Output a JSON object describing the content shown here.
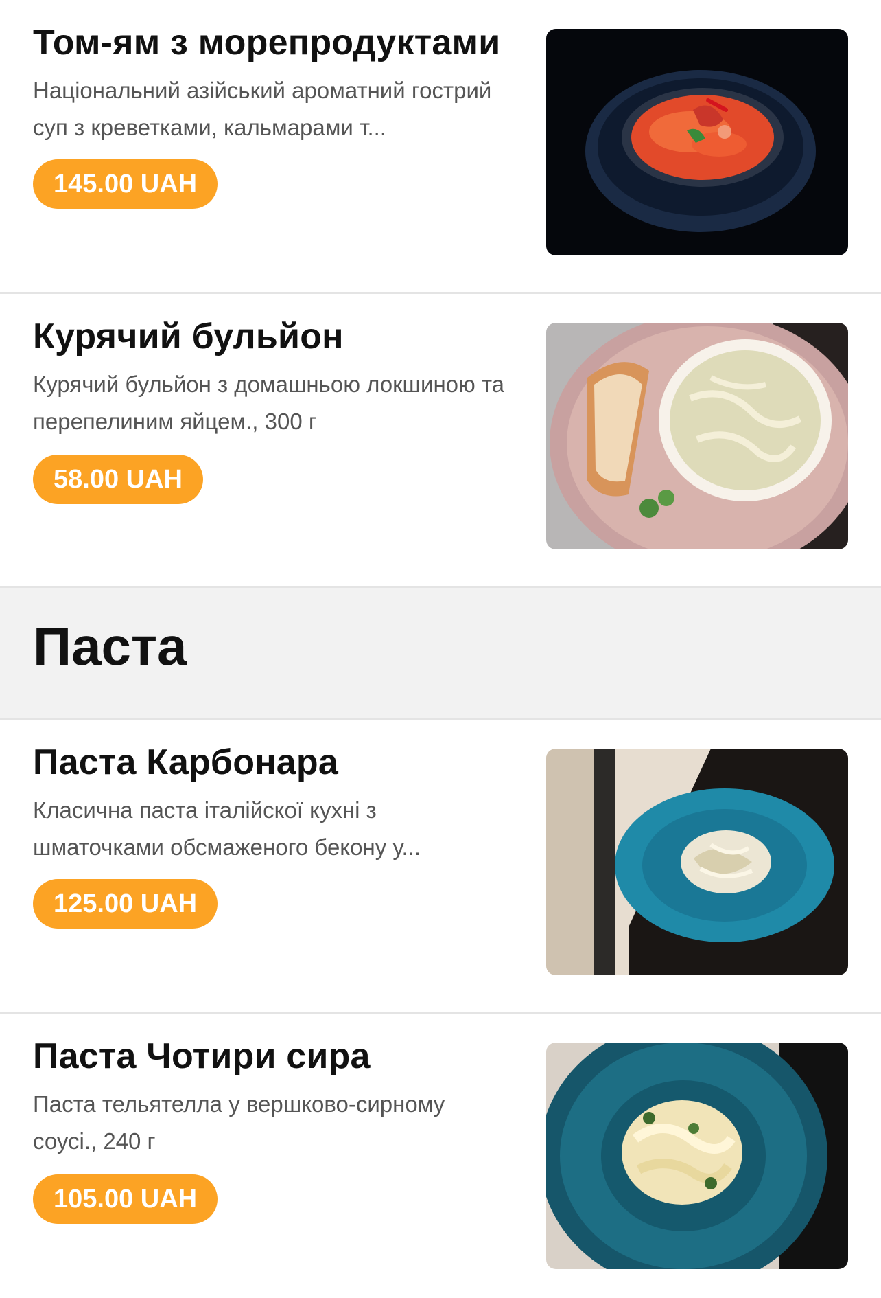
{
  "soups": [
    {
      "title": "Том-ям з морепродуктами",
      "description": "Національний азійський ароматний гострий суп з креветками, кальмарами т...",
      "price": "145.00 UAH",
      "image": "tom-yum-soup-photo"
    },
    {
      "title": "Курячий бульйон",
      "description": "Курячий бульйон з домашньою локшиною та перепелиним яйцем., 300 г",
      "price": "58.00 UAH",
      "image": "chicken-broth-photo"
    }
  ],
  "category": {
    "title": "Паста"
  },
  "pasta": [
    {
      "title": "Паста Карбонара",
      "description": "Класична паста італійскої кухні з шматочками обсмаженого бекону у...",
      "price": "125.00 UAH",
      "image": "carbonara-photo"
    },
    {
      "title": "Паста Чотири сира",
      "description": "Паста тельятелла у вершково-сирному соусі., 240 г",
      "price": "105.00 UAH",
      "image": "four-cheese-pasta-photo"
    }
  ],
  "colors": {
    "accent": "#fca324",
    "title": "#111111",
    "description": "#555555",
    "category_bg": "#f2f2f2",
    "divider": "#e4e4e4"
  }
}
